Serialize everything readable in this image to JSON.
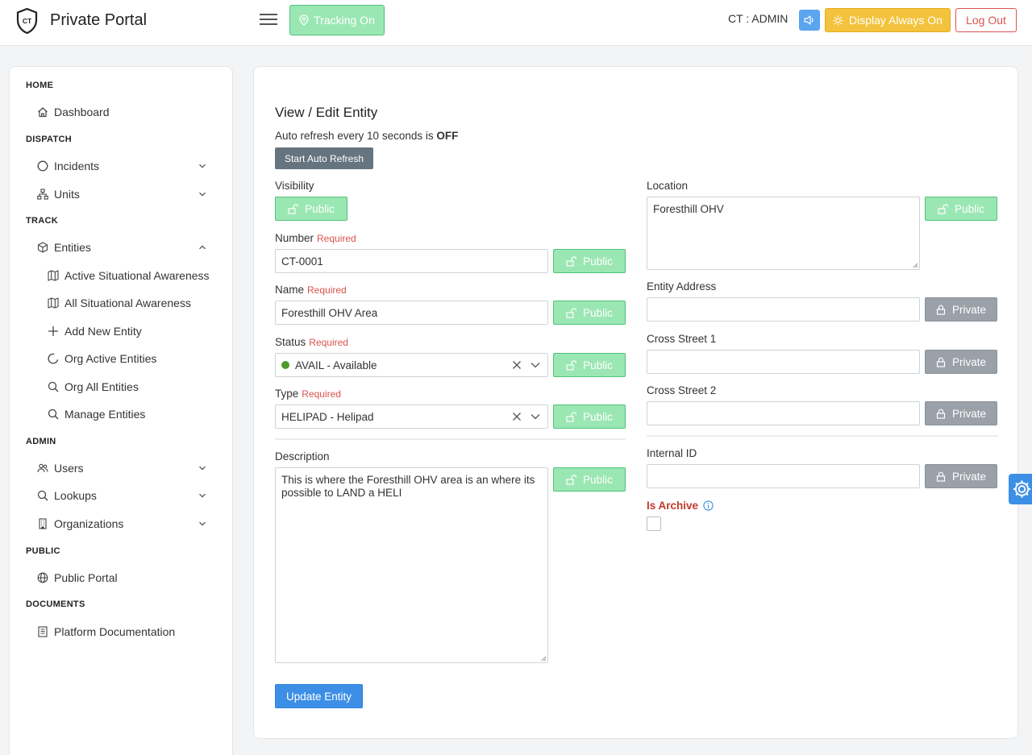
{
  "header": {
    "logo_text": "CT",
    "brand": "Private Portal",
    "tracking_label": "Tracking On",
    "user_label": "CT : ADMIN",
    "display_label": "Display Always On",
    "logout_label": "Log Out"
  },
  "sidebar": {
    "sections": {
      "home": "HOME",
      "dispatch": "DISPATCH",
      "track": "TRACK",
      "admin": "ADMIN",
      "public": "PUBLIC",
      "documents": "DOCUMENTS"
    },
    "items": {
      "dashboard": "Dashboard",
      "incidents": "Incidents",
      "units": "Units",
      "entities": "Entities",
      "active_sa": "Active Situational Awareness",
      "all_sa": "All Situational Awareness",
      "add_entity": "Add New Entity",
      "org_active": "Org Active Entities",
      "org_all": "Org All Entities",
      "manage": "Manage Entities",
      "users": "Users",
      "lookups": "Lookups",
      "organizations": "Organizations",
      "public_portal": "Public Portal",
      "platform_docs": "Platform Documentation"
    }
  },
  "form": {
    "title": "View / Edit Entity",
    "refresh_prefix": "Auto refresh every 10 seconds is",
    "refresh_state": "OFF",
    "auto_refresh_button": "Start Auto Refresh",
    "visibility_label": "Visibility",
    "required_text": "Required",
    "number_label": "Number",
    "number_value": "CT-0001",
    "name_label": "Name",
    "name_value": "Foresthill OHV Area",
    "status_label": "Status",
    "status_value": "AVAIL - Available",
    "type_label": "Type",
    "type_value": "HELIPAD - Helipad",
    "description_label": "Description",
    "description_value": "This is where the Foresthill OHV area is an where its possible to LAND a HELI",
    "location_label": "Location",
    "location_value": "Foresthill OHV",
    "address_label": "Entity Address",
    "address_value": "",
    "cross1_label": "Cross Street 1",
    "cross1_value": "",
    "cross2_label": "Cross Street 2",
    "cross2_value": "",
    "internal_id_label": "Internal ID",
    "internal_id_value": "",
    "archive_label": "Is Archive",
    "public_label": "Public",
    "private_label": "Private",
    "update_button": "Update Entity"
  },
  "colors": {
    "public_green": "#9be7b3",
    "private_gray": "#9aa1a9",
    "primary_blue": "#3d8fe6",
    "warning_yellow": "#f3c33e",
    "danger_red": "#d9534f",
    "status_dot": "#4c9a2a"
  }
}
